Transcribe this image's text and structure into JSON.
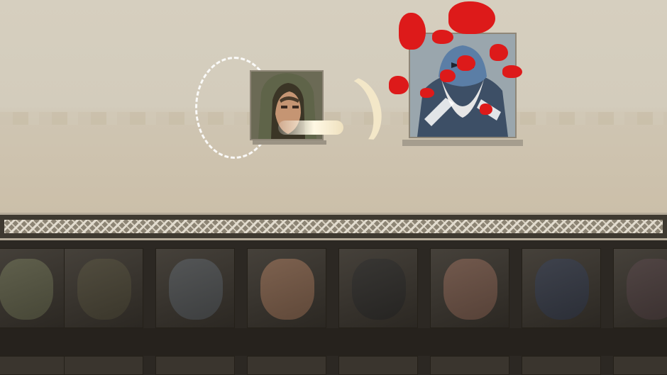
{
  "battle": {
    "hero": {
      "name": "",
      "portrait_icon": "hooded-swordsman-portrait-icon",
      "palette": [
        "#6d6b4d",
        "#c89a70",
        "#3f3a2c"
      ]
    },
    "enemy": {
      "name": "",
      "portrait_icon": "armored-knight-portrait-icon",
      "palette": [
        "#4f6f92",
        "#d7d7d7",
        "#2d3542"
      ]
    },
    "effects": [
      "slash-ring",
      "crescent-slash",
      "blood-splatter"
    ]
  },
  "roster": {
    "row1": [
      {
        "portrait_icon": "ghoul-portrait-icon",
        "tone": "#5a5a45"
      },
      {
        "portrait_icon": "ogre-portrait-icon",
        "tone": "#4a4536"
      },
      {
        "portrait_icon": "shark-portrait-icon",
        "tone": "#4d4f50"
      },
      {
        "portrait_icon": "bearded-warrior-portrait-icon",
        "tone": "#7a5c48"
      },
      {
        "portrait_icon": "thorn-creature-portrait-icon",
        "tone": "#2f2d2a"
      },
      {
        "portrait_icon": "young-man-portrait-icon",
        "tone": "#6e5346"
      },
      {
        "portrait_icon": "bat-swarm-portrait-icon",
        "tone": "#363a45"
      },
      {
        "portrait_icon": "demon-portrait-icon",
        "tone": "#4a3d3c"
      }
    ],
    "row2_count": 8
  },
  "colors": {
    "arena_bg": "#d3ccbc",
    "frame": "#b5ab99",
    "roster_bg": "#2c2823",
    "blood": "#dd1a1a"
  }
}
